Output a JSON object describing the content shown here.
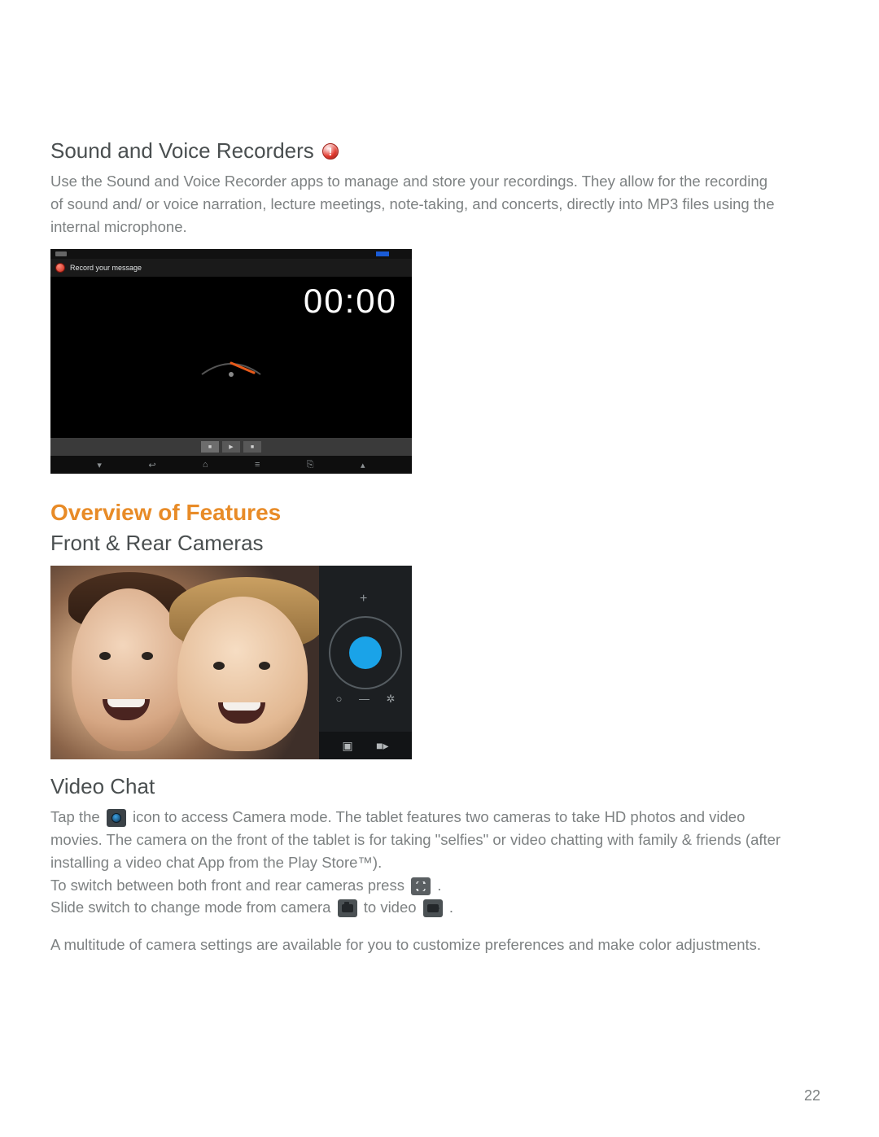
{
  "section1": {
    "heading": "Sound and Voice Recorders",
    "para": "Use the Sound and Voice Recorder apps to manage and store your recordings. They allow for the recording of sound and/ or voice narration, lecture meetings, note-taking, and concerts, directly into MP3 files using the internal microphone."
  },
  "recorder": {
    "titlebar_text": "Record your message",
    "timer": "00:00"
  },
  "section2": {
    "heading_orange": "Overview of Features",
    "heading_sub": "Front & Rear Cameras"
  },
  "video_chat": {
    "heading": "Video Chat",
    "line1_pre": "Tap the ",
    "line1_post": " icon to access Camera mode. The tablet features two cameras to take HD photos and video movies. The camera on the front of the tablet is for taking \"selfies\" or video chatting with family & friends (after installing a video chat App from the Play Store™).",
    "line2_pre": "To switch between both front and rear cameras press ",
    "line2_post": ".",
    "line3_pre": "Slide switch to change mode from camera ",
    "line3_mid": " to video ",
    "line3_post": ".",
    "para2": "A multitude of camera settings are available for you to customize preferences and make color adjustments."
  },
  "page_number": "22"
}
